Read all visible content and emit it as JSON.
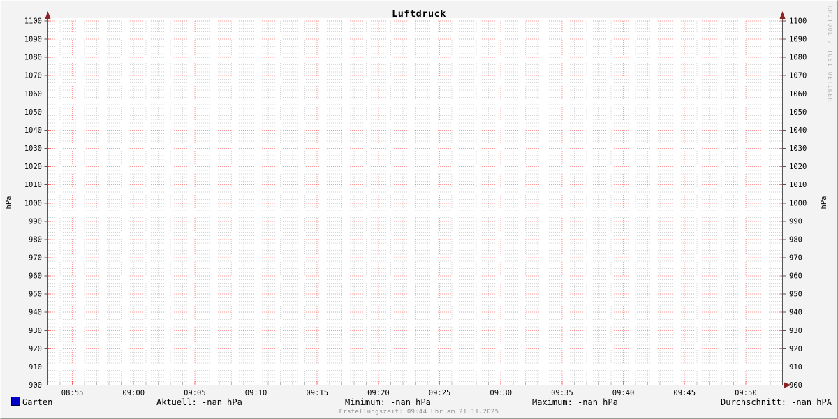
{
  "title": "Luftdruck",
  "watermark": "RRDTOOL / TOBI OETIKER",
  "footer": {
    "created": "Erstellungszeit: 09:44 Uhr am 21.11.2025"
  },
  "legend": {
    "series_label": "Garten",
    "series_color": "#0000c8",
    "aktuell": "Aktuell: -nan hPa",
    "minimum": "Minimum: -nan hPa",
    "maximum": "Maximum: -nan hPa",
    "durchschnitt": "Durchschnitt: -nan hPA"
  },
  "chart_data": {
    "type": "line",
    "title": "Luftdruck",
    "ylabel": "hPa",
    "ylabel_right": "hPa",
    "ylim": [
      900,
      1100
    ],
    "y_ticks": [
      "1100",
      "1090",
      "1080",
      "1070",
      "1060",
      "1050",
      "1040",
      "1030",
      "1020",
      "1010",
      "1000",
      "990",
      "980",
      "970",
      "960",
      "950",
      "940",
      "930",
      "920",
      "910",
      "900"
    ],
    "y_tick_step_major": 10,
    "y_tick_step_minor": 2,
    "x_ticks": [
      "08:55",
      "09:00",
      "09:05",
      "09:10",
      "09:15",
      "09:20",
      "09:25",
      "09:30",
      "09:35",
      "09:40",
      "09:45",
      "09:50"
    ],
    "x_range_minutes": 60,
    "x_start_offset_minutes": 2,
    "x_major_interval_minutes": 5,
    "x_minor_interval_minutes": 1,
    "grid": true,
    "legend_position": "bottom",
    "series": [
      {
        "name": "Garten",
        "color": "#0000c8",
        "values": []
      }
    ],
    "stats": {
      "aktuell": "-nan",
      "minimum": "-nan",
      "maximum": "-nan",
      "durchschnitt": "-nan",
      "unit": "hPa"
    },
    "colors": {
      "background": "#f3f3f3",
      "canvas": "#ffffff",
      "major_grid": "#ff0000",
      "minor_grid": "#d5d5d5",
      "axis": "#555555",
      "arrow": "#8b2323",
      "tick_minor": "#b8b8b8",
      "text": "#000000",
      "watermark": "#b4b4b4",
      "footer_text": "#8f8f8f"
    }
  }
}
